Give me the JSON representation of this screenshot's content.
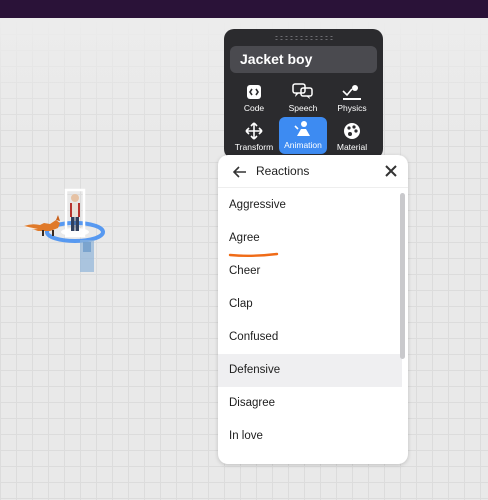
{
  "object_name": "Jacket boy",
  "toolbar": [
    {
      "label": "Code",
      "icon": "code-icon"
    },
    {
      "label": "Speech",
      "icon": "speech-icon"
    },
    {
      "label": "Physics",
      "icon": "physics-icon"
    },
    {
      "label": "Transform",
      "icon": "transform-icon"
    },
    {
      "label": "Animation",
      "icon": "animation-icon",
      "active": true
    },
    {
      "label": "Material",
      "icon": "material-icon"
    }
  ],
  "reactions": {
    "title": "Reactions",
    "items": [
      "Aggressive",
      "Agree",
      "Cheer",
      "Clap",
      "Confused",
      "Defensive",
      "Disagree",
      "In love"
    ],
    "hovered": "Defensive",
    "annotated": "Agree"
  },
  "colors": {
    "topbar": "#2a1238",
    "panel": "#2b2b2e",
    "accent": "#3d8bf2",
    "annotation": "#f06b17"
  }
}
